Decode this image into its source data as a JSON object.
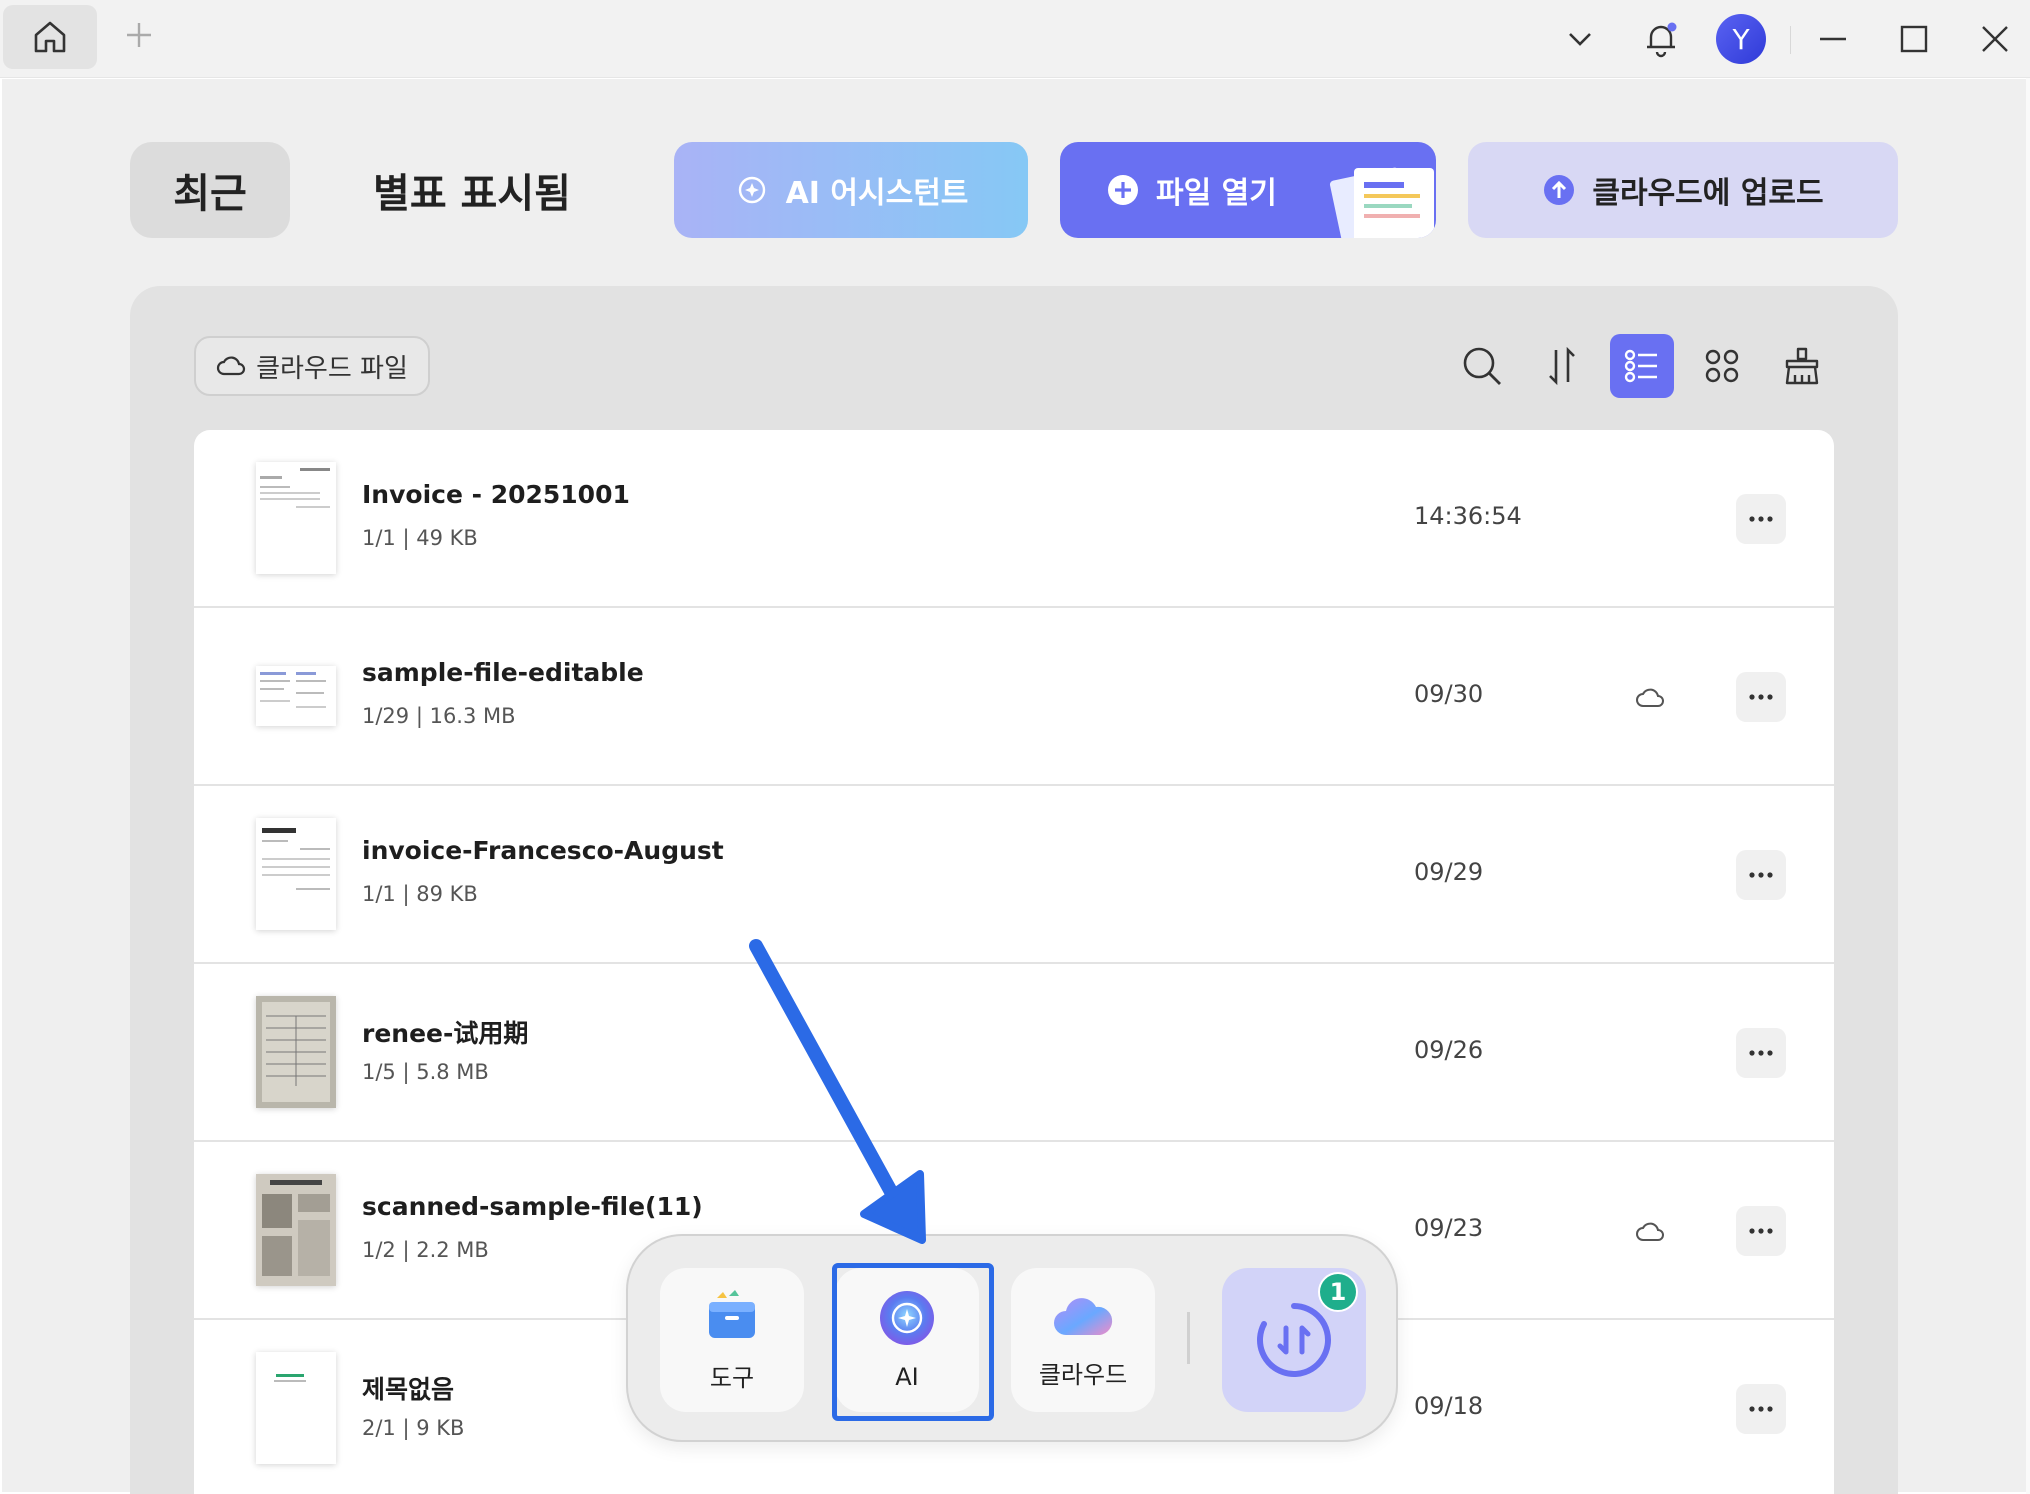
{
  "titlebar": {
    "avatar_letter": "Y"
  },
  "tabs": {
    "recent": "최근",
    "starred": "별표 표시됨"
  },
  "actions": {
    "ai_assistant": "AI 어시스턴트",
    "open_file": "파일 열기",
    "upload_cloud": "클라우드에 업로드"
  },
  "filter": {
    "cloud_files": "클라우드 파일"
  },
  "toolbar": {
    "icons": [
      "search-icon",
      "sort-icon",
      "list-view-icon",
      "grid-view-icon",
      "clean-icon"
    ],
    "active": "list-view-icon"
  },
  "files": [
    {
      "name": "Invoice - 20251001",
      "meta": "1/1 | 49 KB",
      "date": "14:36:54",
      "cloud": false
    },
    {
      "name": "sample-file-editable",
      "meta": "1/29 | 16.3 MB",
      "date": "09/30",
      "cloud": true
    },
    {
      "name": "invoice-Francesco-August",
      "meta": "1/1 | 89 KB",
      "date": "09/29",
      "cloud": false
    },
    {
      "name": "renee-试用期",
      "meta": "1/5 | 5.8 MB",
      "date": "09/26",
      "cloud": false
    },
    {
      "name": "scanned-sample-file(11)",
      "meta": "1/2 | 2.2 MB",
      "date": "09/23",
      "cloud": true
    },
    {
      "name": "제목없음",
      "meta": "2/1 | 9 KB",
      "date": "09/18",
      "cloud": false
    }
  ],
  "dock": {
    "tools": "도구",
    "ai": "AI",
    "cloud": "클라우드",
    "convert_badge": "1"
  },
  "colors": {
    "accent": "#6970f2",
    "highlight": "#2b6ae6",
    "badge": "#1fae8c"
  }
}
